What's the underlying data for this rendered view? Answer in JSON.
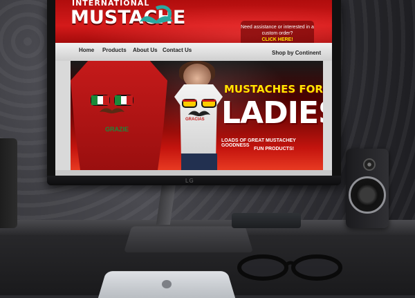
{
  "scene": {
    "monitor_brand": "LG"
  },
  "website": {
    "logo_small": "INTERNATIONAL",
    "logo_big": "MUSTACHE",
    "help_text": "Need assistance or interested in a custom order?",
    "help_cta": "CLICK HERE!",
    "nav": {
      "home": "Home",
      "products": "Products",
      "about": "About Us",
      "contact": "Contact Us",
      "shop_by_continent": "Shop by Continent"
    },
    "banner": {
      "headline_1": "MUSTACHES FOR",
      "headline_2": "LADIES",
      "sub_1": "LOADS OF GREAT MUSTACHEY GOODNESS",
      "sub_2": "FUN PRODUCTS!",
      "shirt_text_red": "GRAZIE",
      "shirt_text_white": "GRACIAS"
    }
  },
  "colors": {
    "brand_red": "#d41a1a",
    "cta_yellow": "#ffe600"
  }
}
